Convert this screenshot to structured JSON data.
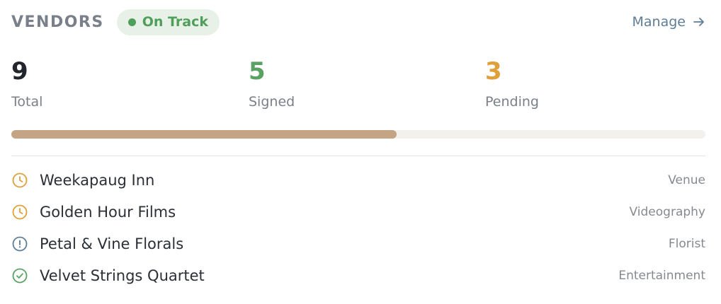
{
  "header": {
    "title": "VENDORS",
    "status_label": "On Track",
    "manage_label": "Manage",
    "arrow_icon": "arrow-right-icon"
  },
  "stats": {
    "total": {
      "value": "9",
      "label": "Total"
    },
    "signed": {
      "value": "5",
      "label": "Signed"
    },
    "pending": {
      "value": "3",
      "label": "Pending"
    }
  },
  "progress": {
    "fraction": 0.555
  },
  "vendors": [
    {
      "name": "Weekapaug Inn",
      "category": "Venue",
      "status_icon": "clock-icon",
      "color": "#dfa03a"
    },
    {
      "name": "Golden Hour Films",
      "category": "Videography",
      "status_icon": "clock-icon",
      "color": "#dfa03a"
    },
    {
      "name": "Petal & Vine Florals",
      "category": "Florist",
      "status_icon": "alert-circle-icon",
      "color": "#5e7d96"
    },
    {
      "name": "Velvet Strings Quartet",
      "category": "Entertainment",
      "status_icon": "check-circle-icon",
      "color": "#5aa264"
    }
  ],
  "colors": {
    "accent": "#c4a484",
    "on_track": "#4f9e5a",
    "signed": "#5aa264",
    "pending": "#dfa03a",
    "link": "#5e7d96"
  }
}
